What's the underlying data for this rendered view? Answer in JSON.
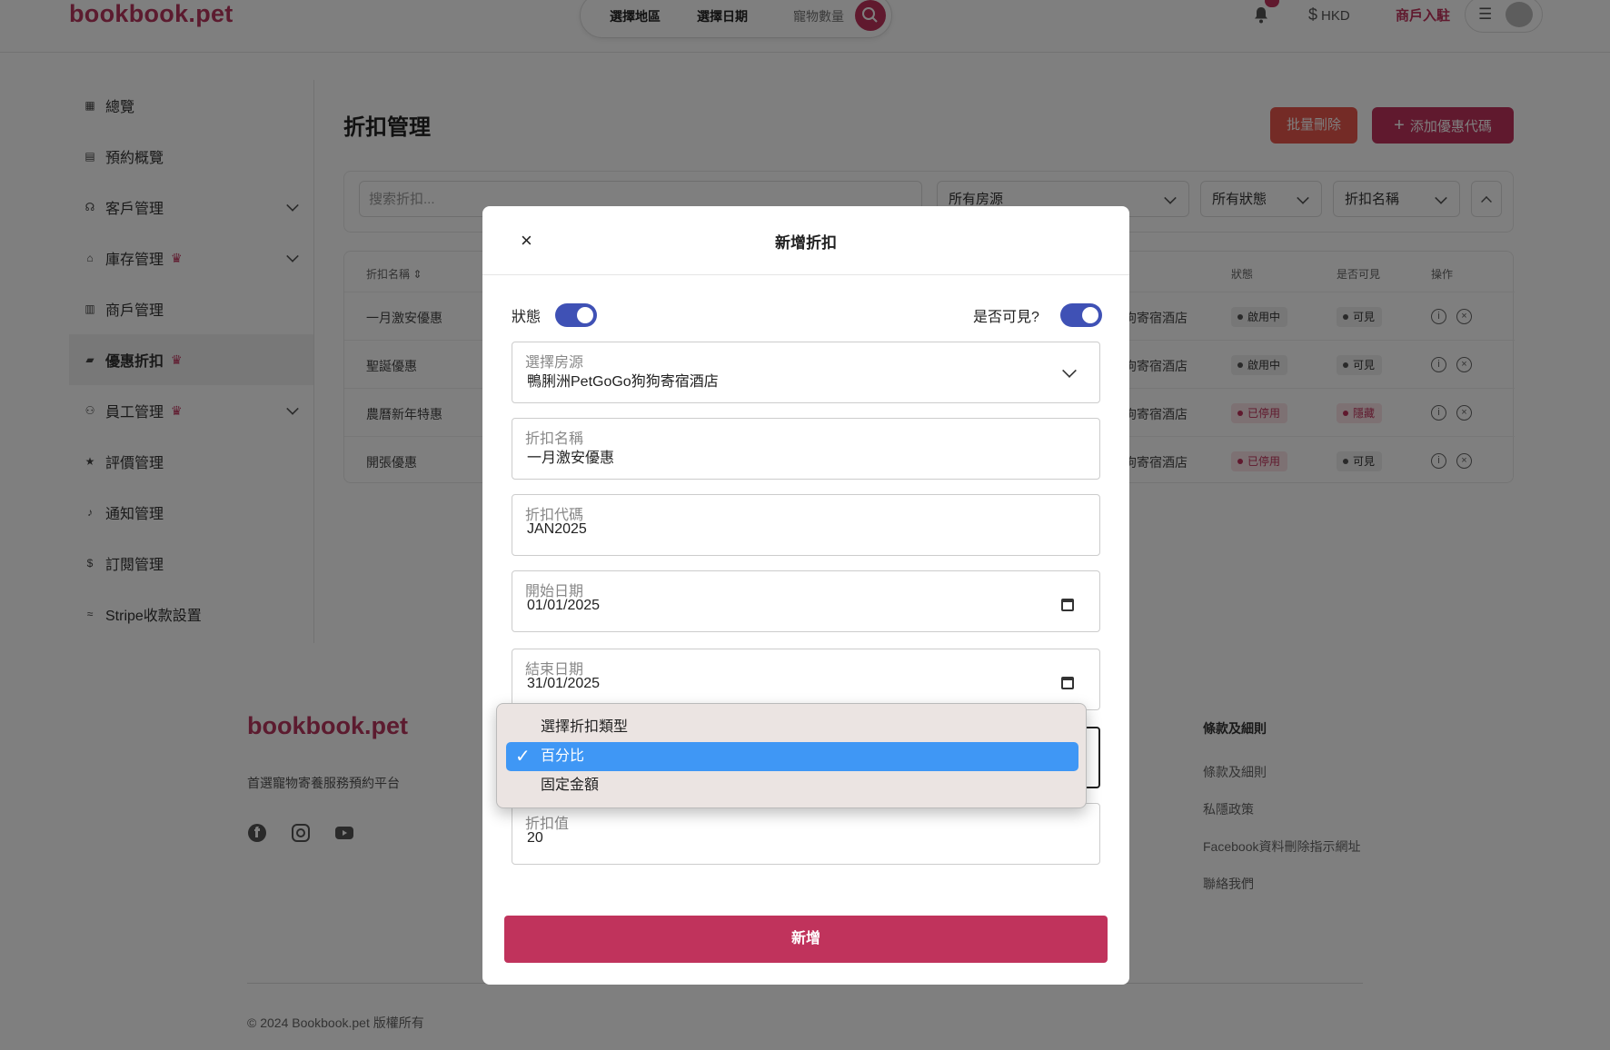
{
  "header": {
    "logo": "bookbook.pet",
    "search": {
      "region": "選擇地區",
      "date": "選擇日期",
      "pets": "寵物數量"
    },
    "notif_count": "",
    "currency": "HKD",
    "merchant_link": "商戶入駐"
  },
  "sidebar": {
    "items": [
      {
        "label": "總覽",
        "icon": "grid-icon"
      },
      {
        "label": "預約概覽",
        "icon": "calendar-icon"
      },
      {
        "label": "客戶管理",
        "icon": "headset-icon"
      },
      {
        "label": "庫存管理",
        "icon": "warehouse-icon"
      },
      {
        "label": "商戶管理",
        "icon": "store-icon"
      },
      {
        "label": "優惠折扣",
        "icon": "ticket-icon"
      },
      {
        "label": "員工管理",
        "icon": "org-icon"
      },
      {
        "label": "評價管理",
        "icon": "star-icon"
      },
      {
        "label": "通知管理",
        "icon": "bell-icon"
      },
      {
        "label": "訂閱管理",
        "icon": "dollar-icon"
      },
      {
        "label": "Stripe收款設置",
        "icon": "stripe-icon"
      }
    ]
  },
  "main": {
    "title": "折扣管理",
    "bulk_delete": "批量刪除",
    "add_code": "添加優惠代碼",
    "filters": {
      "search_placeholder": "搜索折扣...",
      "property": "所有房源",
      "status": "所有狀態",
      "sort": "折扣名稱"
    },
    "table": {
      "headers": {
        "name": "折扣名稱",
        "status": "狀態",
        "visible": "是否可見",
        "actions": "操作"
      },
      "rows": [
        {
          "name": "一月激安優惠",
          "property": "狗寄宿酒店",
          "status": "啟用中",
          "visible": "可見"
        },
        {
          "name": "聖誕優惠",
          "property": "狗寄宿酒店",
          "status": "啟用中",
          "visible": "可見"
        },
        {
          "name": "農曆新年特惠",
          "property": "狗寄宿酒店",
          "status": "已停用",
          "visible": "隱藏"
        },
        {
          "name": "開張優惠",
          "property": "狗寄宿酒店",
          "status": "已停用",
          "visible": "可見"
        }
      ]
    }
  },
  "footer": {
    "logo": "bookbook.pet",
    "tagline": "首選寵物寄養服務預約平台",
    "terms_heading": "條款及細則",
    "links": [
      "條款及細則",
      "私隱政策",
      "Facebook資料刪除指示網址",
      "聯絡我們"
    ],
    "copyright": "© 2024 Bookbook.pet 版權所有"
  },
  "modal": {
    "title": "新增折扣",
    "status_label": "狀態",
    "status_on": true,
    "visible_label": "是否可見?",
    "visible_on": true,
    "property": {
      "label": "選擇房源",
      "value": "鴨脷洲PetGoGo狗狗寄宿酒店"
    },
    "name": {
      "label": "折扣名稱",
      "value": "一月激安優惠"
    },
    "code": {
      "label": "折扣代碼",
      "value": "JAN2025"
    },
    "start": {
      "label": "開始日期",
      "value": "01/01/2025"
    },
    "end": {
      "label": "結束日期",
      "value": "31/01/2025"
    },
    "discount_value": {
      "label": "折扣值",
      "value": "20"
    },
    "submit": "新增"
  },
  "dropdown": {
    "options": [
      "選擇折扣類型",
      "百分比",
      "固定金額"
    ],
    "selected": "百分比"
  }
}
